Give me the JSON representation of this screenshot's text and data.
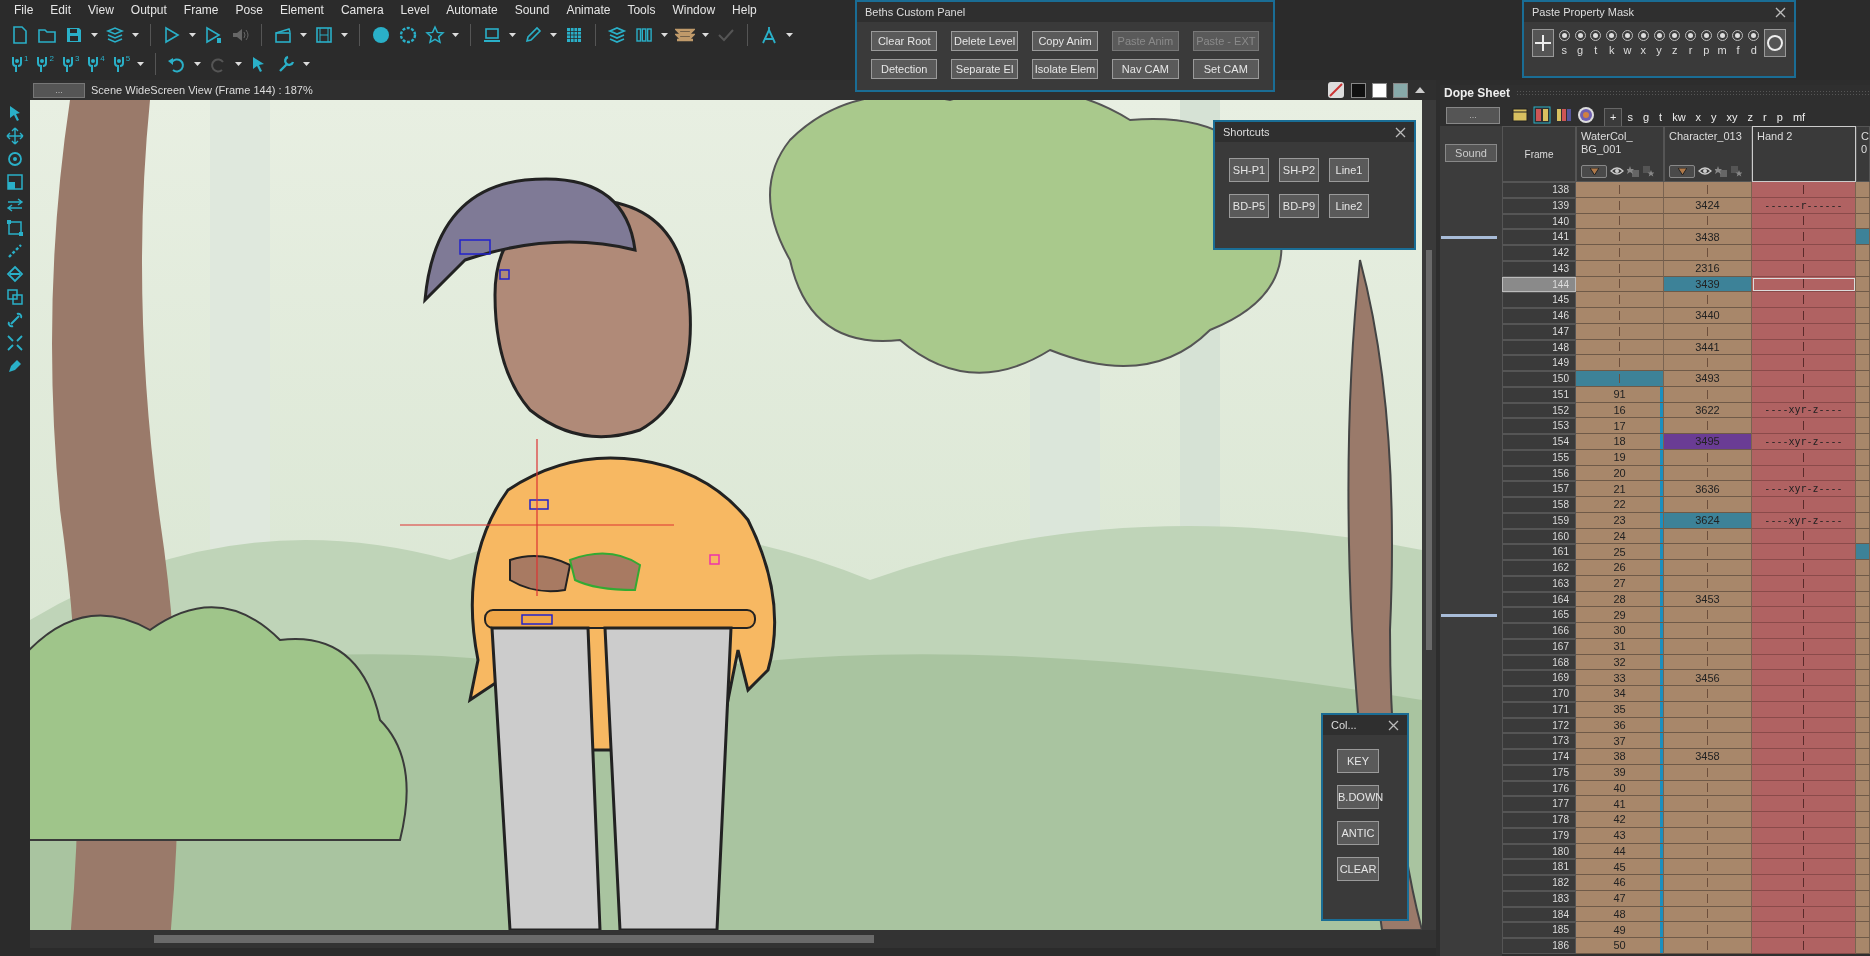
{
  "menu": [
    "File",
    "Edit",
    "View",
    "Output",
    "Frame",
    "Pose",
    "Element",
    "Camera",
    "Level",
    "Automate",
    "Sound",
    "Animate",
    "Tools",
    "Window",
    "Help"
  ],
  "peg_tools": [
    "1",
    "2",
    "3",
    "4",
    "5"
  ],
  "view": {
    "button": "...",
    "title": "Scene WideScreen View (Frame 144) : 187%"
  },
  "custom_panel": {
    "title": "Beths Custom Panel",
    "buttons": [
      {
        "label": "Clear Root",
        "disabled": false
      },
      {
        "label": "Delete Level",
        "disabled": false
      },
      {
        "label": "Copy Anim",
        "disabled": false
      },
      {
        "label": "Paste Anim",
        "disabled": true
      },
      {
        "label": "Paste - EXT",
        "disabled": true
      },
      {
        "label": "Detection",
        "disabled": false
      },
      {
        "label": "Separate El",
        "disabled": false
      },
      {
        "label": "Isolate Elem",
        "disabled": false
      },
      {
        "label": "Nav CAM",
        "disabled": false
      },
      {
        "label": "Set CAM",
        "disabled": false
      }
    ]
  },
  "paste_mask": {
    "title": "Paste Property Mask",
    "properties": [
      {
        "label": "s",
        "checked": true
      },
      {
        "label": "g",
        "checked": true
      },
      {
        "label": "t",
        "checked": true
      },
      {
        "label": "k",
        "checked": true
      },
      {
        "label": "w",
        "checked": true
      },
      {
        "label": "x",
        "checked": true
      },
      {
        "label": "y",
        "checked": true
      },
      {
        "label": "z",
        "checked": true
      },
      {
        "label": "r",
        "checked": true
      },
      {
        "label": "p",
        "checked": true
      },
      {
        "label": "m",
        "checked": true
      },
      {
        "label": "f",
        "checked": true
      },
      {
        "label": "d",
        "checked": true
      }
    ]
  },
  "shortcuts": {
    "title": "Shortcuts",
    "buttons": [
      "SH-P1",
      "SH-P2",
      "Line1",
      "BD-P5",
      "BD-P9",
      "Line2"
    ]
  },
  "col_panel": {
    "title": "Col...",
    "buttons": [
      "KEY",
      "B.DOWN",
      "ANTIC",
      "CLEAR"
    ]
  },
  "dope_sheet": {
    "title": "Dope Sheet",
    "menu_button": "...",
    "sound_button": "Sound",
    "frame_header": "Frame",
    "tabs": [
      {
        "label": "+",
        "selected": true
      },
      {
        "label": "s",
        "selected": false
      },
      {
        "label": "g",
        "selected": false
      },
      {
        "label": "t",
        "selected": false
      },
      {
        "label": "kw",
        "selected": false
      },
      {
        "label": "x",
        "selected": false
      },
      {
        "label": "y",
        "selected": false
      },
      {
        "label": "xy",
        "selected": false
      },
      {
        "label": "z",
        "selected": false
      },
      {
        "label": "r",
        "selected": false
      },
      {
        "label": "p",
        "selected": false
      },
      {
        "label": "mf",
        "selected": false
      }
    ],
    "columns": [
      {
        "name_lines": [
          "WaterCol_",
          "BG_001"
        ],
        "selected": false
      },
      {
        "name_lines": [
          "Character_013"
        ],
        "selected": false
      },
      {
        "name_lines": [
          "Hand 2"
        ],
        "selected": true
      },
      {
        "name_lines": [
          "C",
          "0"
        ],
        "selected": false
      }
    ],
    "rows": [
      {
        "frame": "138",
        "cells": [
          "",
          "",
          "",
          ""
        ],
        "selected": [
          false,
          false,
          false,
          false
        ],
        "flagged": [
          false,
          false,
          false,
          false
        ],
        "current": false
      },
      {
        "frame": "139",
        "cells": [
          "",
          "3424",
          "------r------",
          ""
        ],
        "selected": [
          false,
          false,
          false,
          false
        ],
        "flagged": [
          false,
          false,
          false,
          false
        ],
        "current": false
      },
      {
        "frame": "140",
        "cells": [
          "",
          "",
          "",
          ""
        ],
        "selected": [
          false,
          false,
          false,
          false
        ],
        "flagged": [
          false,
          false,
          false,
          false
        ],
        "current": false
      },
      {
        "frame": "141",
        "cells": [
          "",
          "3438",
          "",
          ""
        ],
        "selected": [
          false,
          false,
          false,
          true
        ],
        "flagged": [
          false,
          false,
          false,
          false
        ],
        "current": false
      },
      {
        "frame": "142",
        "cells": [
          "",
          "",
          "",
          ""
        ],
        "selected": [
          false,
          false,
          false,
          false
        ],
        "flagged": [
          false,
          false,
          false,
          false
        ],
        "current": false
      },
      {
        "frame": "143",
        "cells": [
          "",
          "2316",
          "",
          ""
        ],
        "selected": [
          false,
          false,
          false,
          false
        ],
        "flagged": [
          false,
          false,
          false,
          false
        ],
        "current": false
      },
      {
        "frame": "144",
        "cells": [
          "",
          "3439",
          "",
          ""
        ],
        "selected": [
          false,
          true,
          false,
          false
        ],
        "flagged": [
          false,
          false,
          false,
          false
        ],
        "current": true
      },
      {
        "frame": "145",
        "cells": [
          "",
          "",
          "",
          ""
        ],
        "selected": [
          false,
          false,
          false,
          false
        ],
        "flagged": [
          false,
          false,
          false,
          false
        ],
        "current": false
      },
      {
        "frame": "146",
        "cells": [
          "",
          "3440",
          "",
          ""
        ],
        "selected": [
          false,
          false,
          false,
          false
        ],
        "flagged": [
          false,
          false,
          false,
          false
        ],
        "current": false
      },
      {
        "frame": "147",
        "cells": [
          "",
          "",
          "",
          ""
        ],
        "selected": [
          false,
          false,
          false,
          false
        ],
        "flagged": [
          false,
          false,
          false,
          false
        ],
        "current": false
      },
      {
        "frame": "148",
        "cells": [
          "",
          "3441",
          "",
          ""
        ],
        "selected": [
          false,
          false,
          false,
          false
        ],
        "flagged": [
          false,
          false,
          false,
          false
        ],
        "current": false
      },
      {
        "frame": "149",
        "cells": [
          "",
          "",
          "",
          ""
        ],
        "selected": [
          false,
          false,
          false,
          false
        ],
        "flagged": [
          false,
          false,
          false,
          false
        ],
        "current": false
      },
      {
        "frame": "150",
        "cells": [
          "",
          "3493",
          "",
          ""
        ],
        "selected": [
          true,
          false,
          false,
          false
        ],
        "flagged": [
          false,
          false,
          false,
          false
        ],
        "current": false
      },
      {
        "frame": "151",
        "cells": [
          "91",
          "",
          "",
          ""
        ],
        "selected": [
          false,
          false,
          false,
          false
        ],
        "flagged": [
          false,
          false,
          false,
          false
        ],
        "current": false
      },
      {
        "frame": "152",
        "cells": [
          "16",
          "3622",
          "----xyr-z----",
          ""
        ],
        "selected": [
          false,
          false,
          false,
          false
        ],
        "flagged": [
          false,
          false,
          false,
          false
        ],
        "current": false
      },
      {
        "frame": "153",
        "cells": [
          "17",
          "",
          "",
          ""
        ],
        "selected": [
          false,
          false,
          false,
          false
        ],
        "flagged": [
          false,
          false,
          false,
          false
        ],
        "current": false
      },
      {
        "frame": "154",
        "cells": [
          "18",
          "3495",
          "----xyr-z----",
          ""
        ],
        "selected": [
          false,
          false,
          false,
          false
        ],
        "flagged": [
          false,
          true,
          false,
          false
        ],
        "current": false
      },
      {
        "frame": "155",
        "cells": [
          "19",
          "",
          "",
          ""
        ],
        "selected": [
          false,
          false,
          false,
          false
        ],
        "flagged": [
          false,
          false,
          false,
          false
        ],
        "current": false
      },
      {
        "frame": "156",
        "cells": [
          "20",
          "",
          "",
          ""
        ],
        "selected": [
          false,
          false,
          false,
          false
        ],
        "flagged": [
          false,
          false,
          false,
          false
        ],
        "current": false
      },
      {
        "frame": "157",
        "cells": [
          "21",
          "3636",
          "----xyr-z----",
          ""
        ],
        "selected": [
          false,
          false,
          false,
          false
        ],
        "flagged": [
          false,
          false,
          false,
          false
        ],
        "current": false
      },
      {
        "frame": "158",
        "cells": [
          "22",
          "",
          "",
          ""
        ],
        "selected": [
          false,
          false,
          false,
          false
        ],
        "flagged": [
          false,
          false,
          false,
          false
        ],
        "current": false
      },
      {
        "frame": "159",
        "cells": [
          "23",
          "3624",
          "----xyr-z----",
          ""
        ],
        "selected": [
          false,
          true,
          false,
          false
        ],
        "flagged": [
          false,
          false,
          false,
          false
        ],
        "current": false
      },
      {
        "frame": "160",
        "cells": [
          "24",
          "",
          "",
          ""
        ],
        "selected": [
          false,
          false,
          false,
          false
        ],
        "flagged": [
          false,
          false,
          false,
          false
        ],
        "current": false
      },
      {
        "frame": "161",
        "cells": [
          "25",
          "",
          "",
          ""
        ],
        "selected": [
          false,
          false,
          false,
          true
        ],
        "flagged": [
          false,
          false,
          false,
          false
        ],
        "current": false
      },
      {
        "frame": "162",
        "cells": [
          "26",
          "",
          "",
          ""
        ],
        "selected": [
          false,
          false,
          false,
          false
        ],
        "flagged": [
          false,
          false,
          false,
          false
        ],
        "current": false
      },
      {
        "frame": "163",
        "cells": [
          "27",
          "",
          "",
          ""
        ],
        "selected": [
          false,
          false,
          false,
          false
        ],
        "flagged": [
          false,
          false,
          false,
          false
        ],
        "current": false
      },
      {
        "frame": "164",
        "cells": [
          "28",
          "3453",
          "",
          ""
        ],
        "selected": [
          false,
          false,
          false,
          false
        ],
        "flagged": [
          false,
          false,
          false,
          false
        ],
        "current": false
      },
      {
        "frame": "165",
        "cells": [
          "29",
          "",
          "",
          ""
        ],
        "selected": [
          false,
          false,
          false,
          false
        ],
        "flagged": [
          false,
          false,
          false,
          false
        ],
        "current": false
      },
      {
        "frame": "166",
        "cells": [
          "30",
          "",
          "",
          ""
        ],
        "selected": [
          false,
          false,
          false,
          false
        ],
        "flagged": [
          false,
          false,
          false,
          false
        ],
        "current": false
      },
      {
        "frame": "167",
        "cells": [
          "31",
          "",
          "",
          ""
        ],
        "selected": [
          false,
          false,
          false,
          false
        ],
        "flagged": [
          false,
          false,
          false,
          false
        ],
        "current": false
      },
      {
        "frame": "168",
        "cells": [
          "32",
          "",
          "",
          ""
        ],
        "selected": [
          false,
          false,
          false,
          false
        ],
        "flagged": [
          false,
          false,
          false,
          false
        ],
        "current": false
      },
      {
        "frame": "169",
        "cells": [
          "33",
          "3456",
          "",
          ""
        ],
        "selected": [
          false,
          false,
          false,
          false
        ],
        "flagged": [
          false,
          false,
          false,
          false
        ],
        "current": false
      },
      {
        "frame": "170",
        "cells": [
          "34",
          "",
          "",
          ""
        ],
        "selected": [
          false,
          false,
          false,
          false
        ],
        "flagged": [
          false,
          false,
          false,
          false
        ],
        "current": false
      },
      {
        "frame": "171",
        "cells": [
          "35",
          "",
          "",
          ""
        ],
        "selected": [
          false,
          false,
          false,
          false
        ],
        "flagged": [
          false,
          false,
          false,
          false
        ],
        "current": false
      },
      {
        "frame": "172",
        "cells": [
          "36",
          "",
          "",
          ""
        ],
        "selected": [
          false,
          false,
          false,
          false
        ],
        "flagged": [
          false,
          false,
          false,
          false
        ],
        "current": false
      },
      {
        "frame": "173",
        "cells": [
          "37",
          "",
          "",
          ""
        ],
        "selected": [
          false,
          false,
          false,
          false
        ],
        "flagged": [
          false,
          false,
          false,
          false
        ],
        "current": false
      },
      {
        "frame": "174",
        "cells": [
          "38",
          "3458",
          "",
          ""
        ],
        "selected": [
          false,
          false,
          false,
          false
        ],
        "flagged": [
          false,
          false,
          false,
          false
        ],
        "current": false
      },
      {
        "frame": "175",
        "cells": [
          "39",
          "",
          "",
          ""
        ],
        "selected": [
          false,
          false,
          false,
          false
        ],
        "flagged": [
          false,
          false,
          false,
          false
        ],
        "current": false
      },
      {
        "frame": "176",
        "cells": [
          "40",
          "",
          "",
          ""
        ],
        "selected": [
          false,
          false,
          false,
          false
        ],
        "flagged": [
          false,
          false,
          false,
          false
        ],
        "current": false
      },
      {
        "frame": "177",
        "cells": [
          "41",
          "",
          "",
          ""
        ],
        "selected": [
          false,
          false,
          false,
          false
        ],
        "flagged": [
          false,
          false,
          false,
          false
        ],
        "current": false
      },
      {
        "frame": "178",
        "cells": [
          "42",
          "",
          "",
          ""
        ],
        "selected": [
          false,
          false,
          false,
          false
        ],
        "flagged": [
          false,
          false,
          false,
          false
        ],
        "current": false
      },
      {
        "frame": "179",
        "cells": [
          "43",
          "",
          "",
          ""
        ],
        "selected": [
          false,
          false,
          false,
          false
        ],
        "flagged": [
          false,
          false,
          false,
          false
        ],
        "current": false
      },
      {
        "frame": "180",
        "cells": [
          "44",
          "",
          "",
          ""
        ],
        "selected": [
          false,
          false,
          false,
          false
        ],
        "flagged": [
          false,
          false,
          false,
          false
        ],
        "current": false
      },
      {
        "frame": "181",
        "cells": [
          "45",
          "",
          "",
          ""
        ],
        "selected": [
          false,
          false,
          false,
          false
        ],
        "flagged": [
          false,
          false,
          false,
          false
        ],
        "current": false
      },
      {
        "frame": "182",
        "cells": [
          "46",
          "",
          "",
          ""
        ],
        "selected": [
          false,
          false,
          false,
          false
        ],
        "flagged": [
          false,
          false,
          false,
          false
        ],
        "current": false
      },
      {
        "frame": "183",
        "cells": [
          "47",
          "",
          "",
          ""
        ],
        "selected": [
          false,
          false,
          false,
          false
        ],
        "flagged": [
          false,
          false,
          false,
          false
        ],
        "current": false
      },
      {
        "frame": "184",
        "cells": [
          "48",
          "",
          "",
          ""
        ],
        "selected": [
          false,
          false,
          false,
          false
        ],
        "flagged": [
          false,
          false,
          false,
          false
        ],
        "current": false
      },
      {
        "frame": "185",
        "cells": [
          "49",
          "",
          "",
          ""
        ],
        "selected": [
          false,
          false,
          false,
          false
        ],
        "flagged": [
          false,
          false,
          false,
          false
        ],
        "current": false
      },
      {
        "frame": "186",
        "cells": [
          "50",
          "",
          "",
          ""
        ],
        "selected": [
          false,
          false,
          false,
          false
        ],
        "flagged": [
          false,
          false,
          false,
          false
        ],
        "current": false
      }
    ]
  }
}
